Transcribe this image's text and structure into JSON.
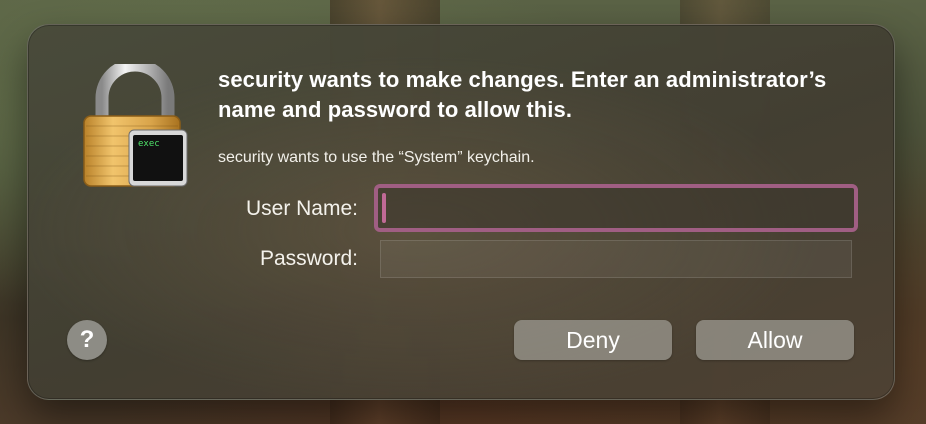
{
  "dialog": {
    "headline": "security wants to make changes. Enter an administrator’s name and password to allow this.",
    "subtext": "security wants to use the “System” keychain.",
    "icon": "padlock-icon",
    "icon_badge_text": "exec",
    "user_name_label": "User Name:",
    "user_name_value": "",
    "password_label": "Password:",
    "password_value": "",
    "help_label": "?",
    "deny_label": "Deny",
    "allow_label": "Allow",
    "focus_ring_color": "#a05e83"
  }
}
